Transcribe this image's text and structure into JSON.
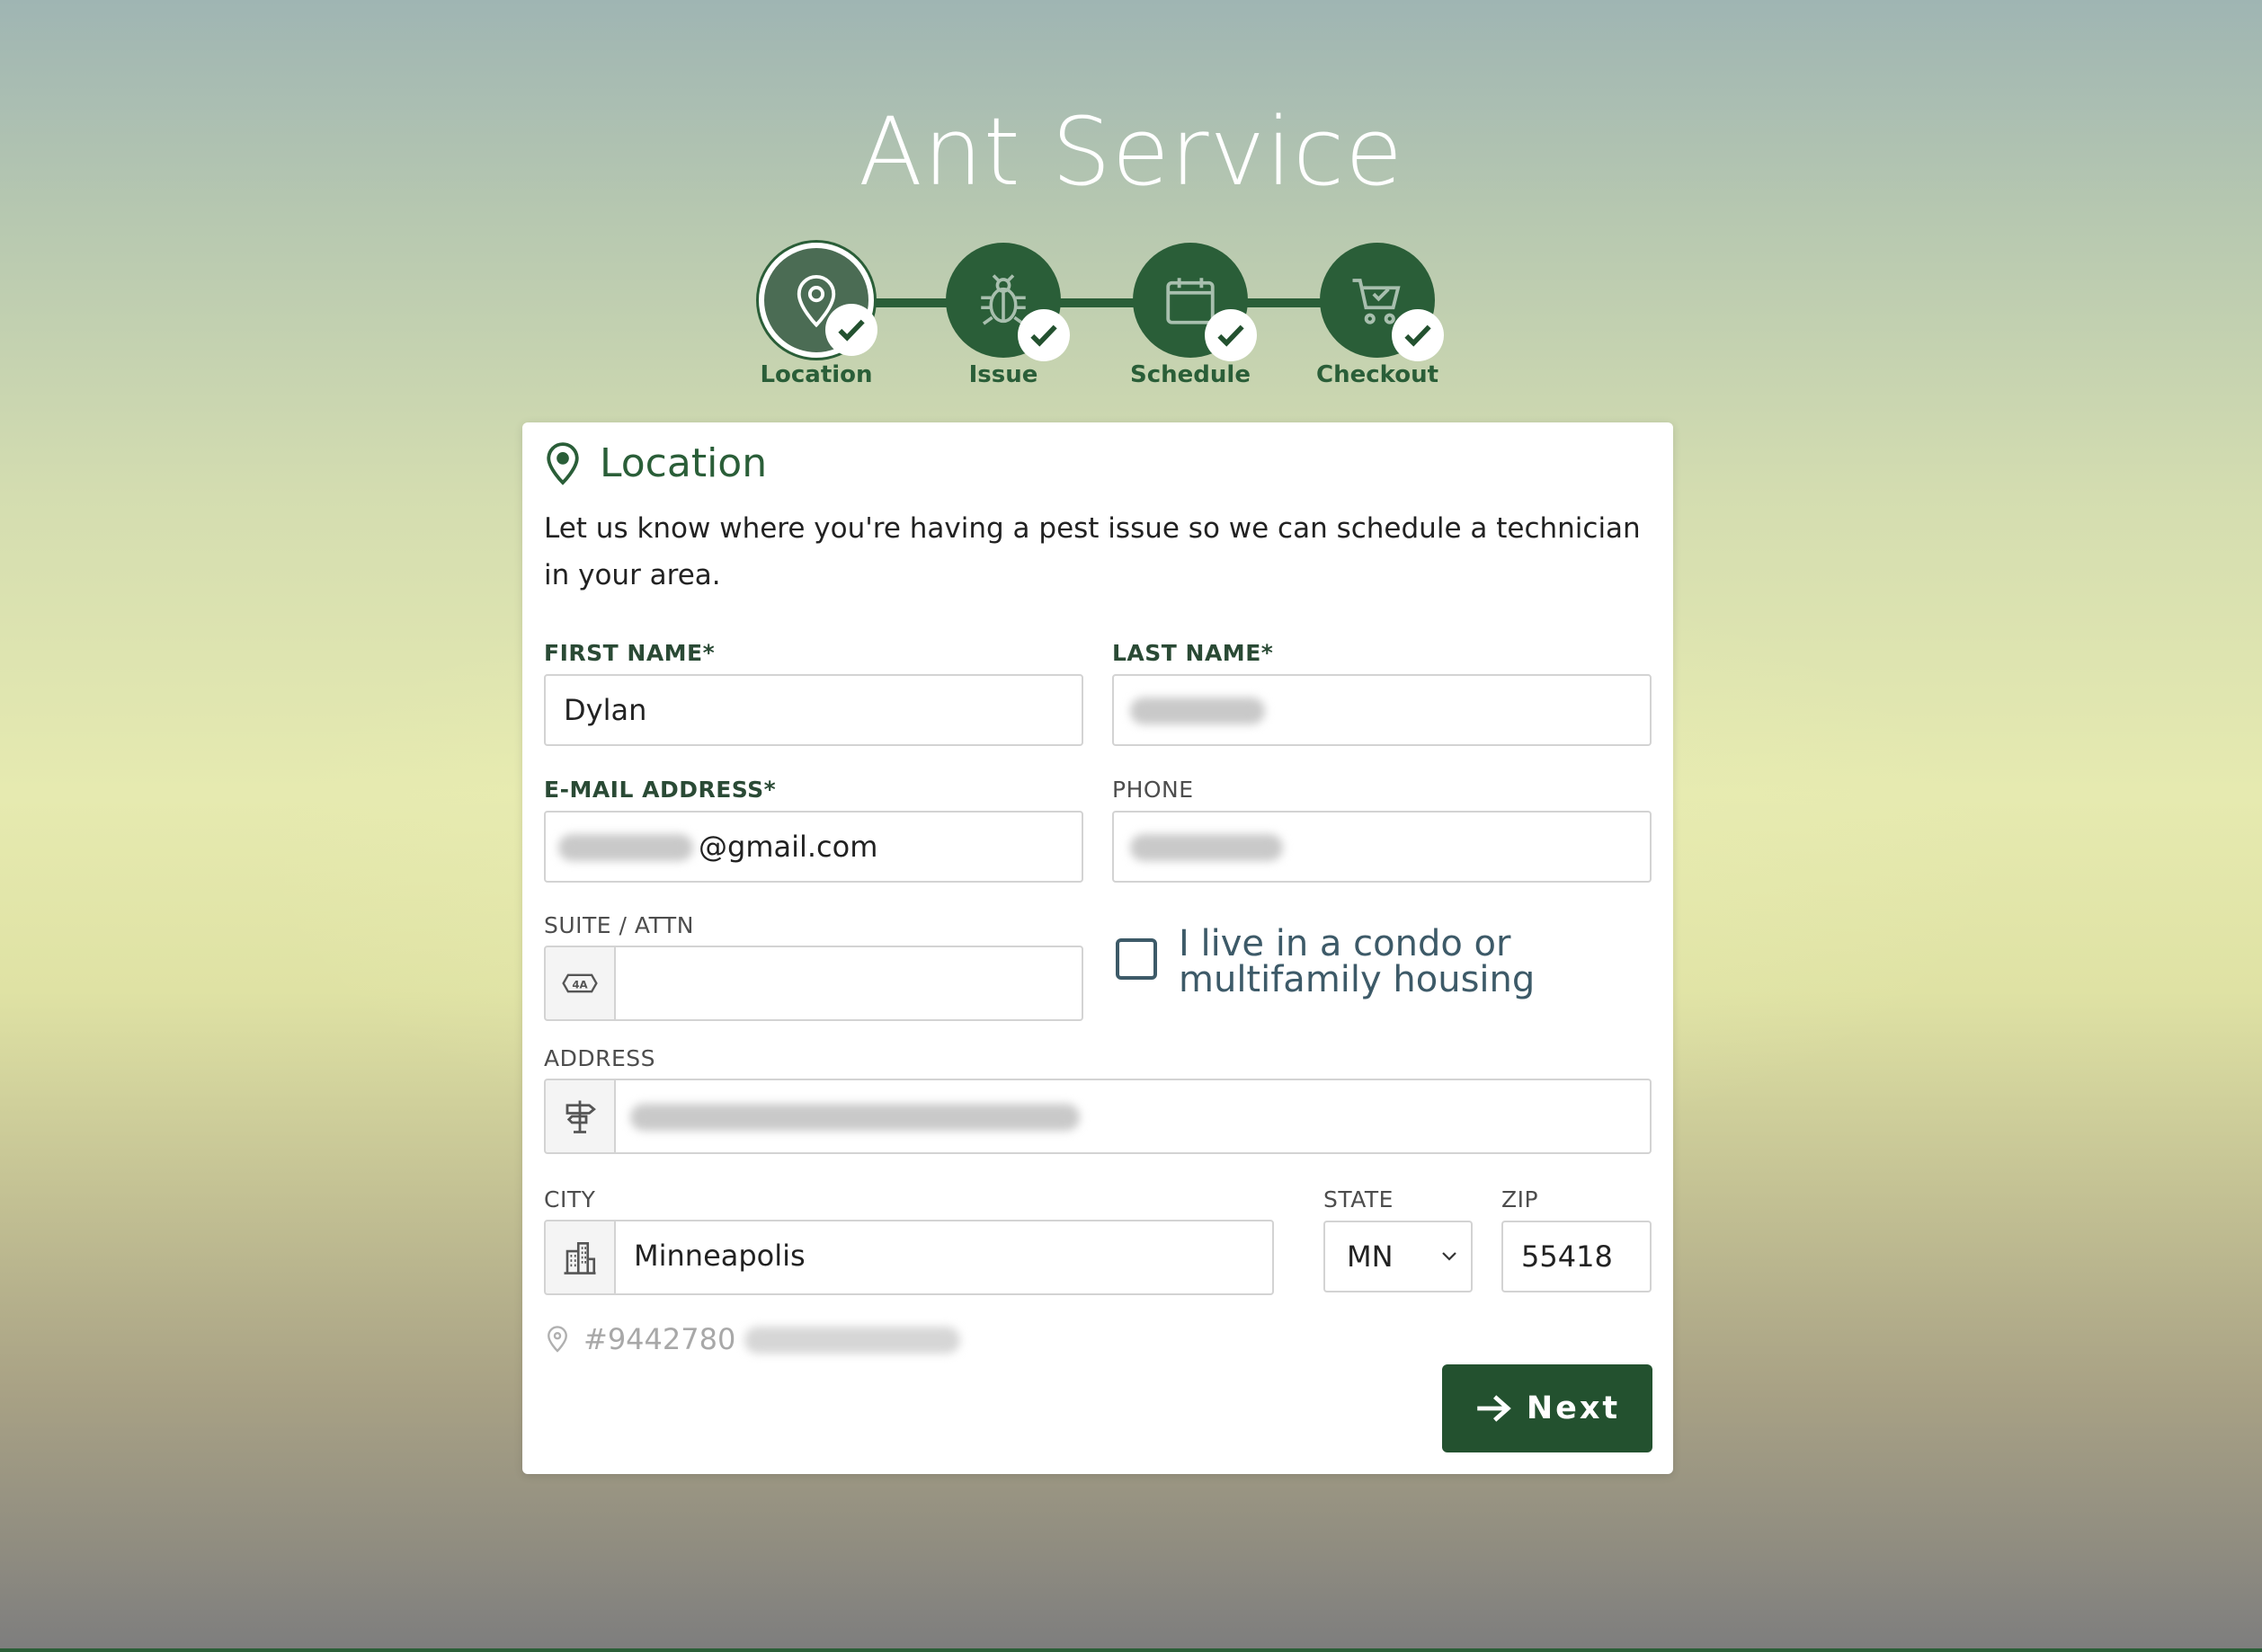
{
  "page": {
    "title": "Ant Service"
  },
  "stepper": {
    "steps": [
      {
        "label": "Location",
        "icon": "map-pin-icon",
        "completed": true,
        "active": true
      },
      {
        "label": "Issue",
        "icon": "bug-icon",
        "completed": true,
        "active": false
      },
      {
        "label": "Schedule",
        "icon": "calendar-icon",
        "completed": true,
        "active": false
      },
      {
        "label": "Checkout",
        "icon": "cart-icon",
        "completed": true,
        "active": false
      }
    ]
  },
  "card": {
    "title": "Location",
    "intro": "Let us know where you're having a pest issue so we can schedule a technician in your area."
  },
  "form": {
    "first_name": {
      "label": "FIRST NAME*",
      "value": "Dylan"
    },
    "last_name": {
      "label": "LAST NAME*",
      "value": ""
    },
    "email": {
      "label": "E-MAIL ADDRESS*",
      "value": "@gmail.com"
    },
    "phone": {
      "label": "PHONE",
      "value": ""
    },
    "suite": {
      "label": "SUITE / ATTN",
      "value": "",
      "icon": "suite-badge-icon"
    },
    "condo_checkbox": {
      "label": "I live in a condo or multifamily housing",
      "checked": false
    },
    "address": {
      "label": "ADDRESS",
      "value": "",
      "icon": "signpost-icon"
    },
    "city": {
      "label": "CITY",
      "value": "Minneapolis",
      "icon": "buildings-icon"
    },
    "state": {
      "label": "STATE",
      "value": "MN"
    },
    "zip": {
      "label": "ZIP",
      "value": "55418"
    }
  },
  "location_id": {
    "text": "#9442780"
  },
  "next_button": {
    "label": "Next"
  },
  "colors": {
    "brand_green": "#23512f",
    "step_green": "#2a5e38"
  }
}
